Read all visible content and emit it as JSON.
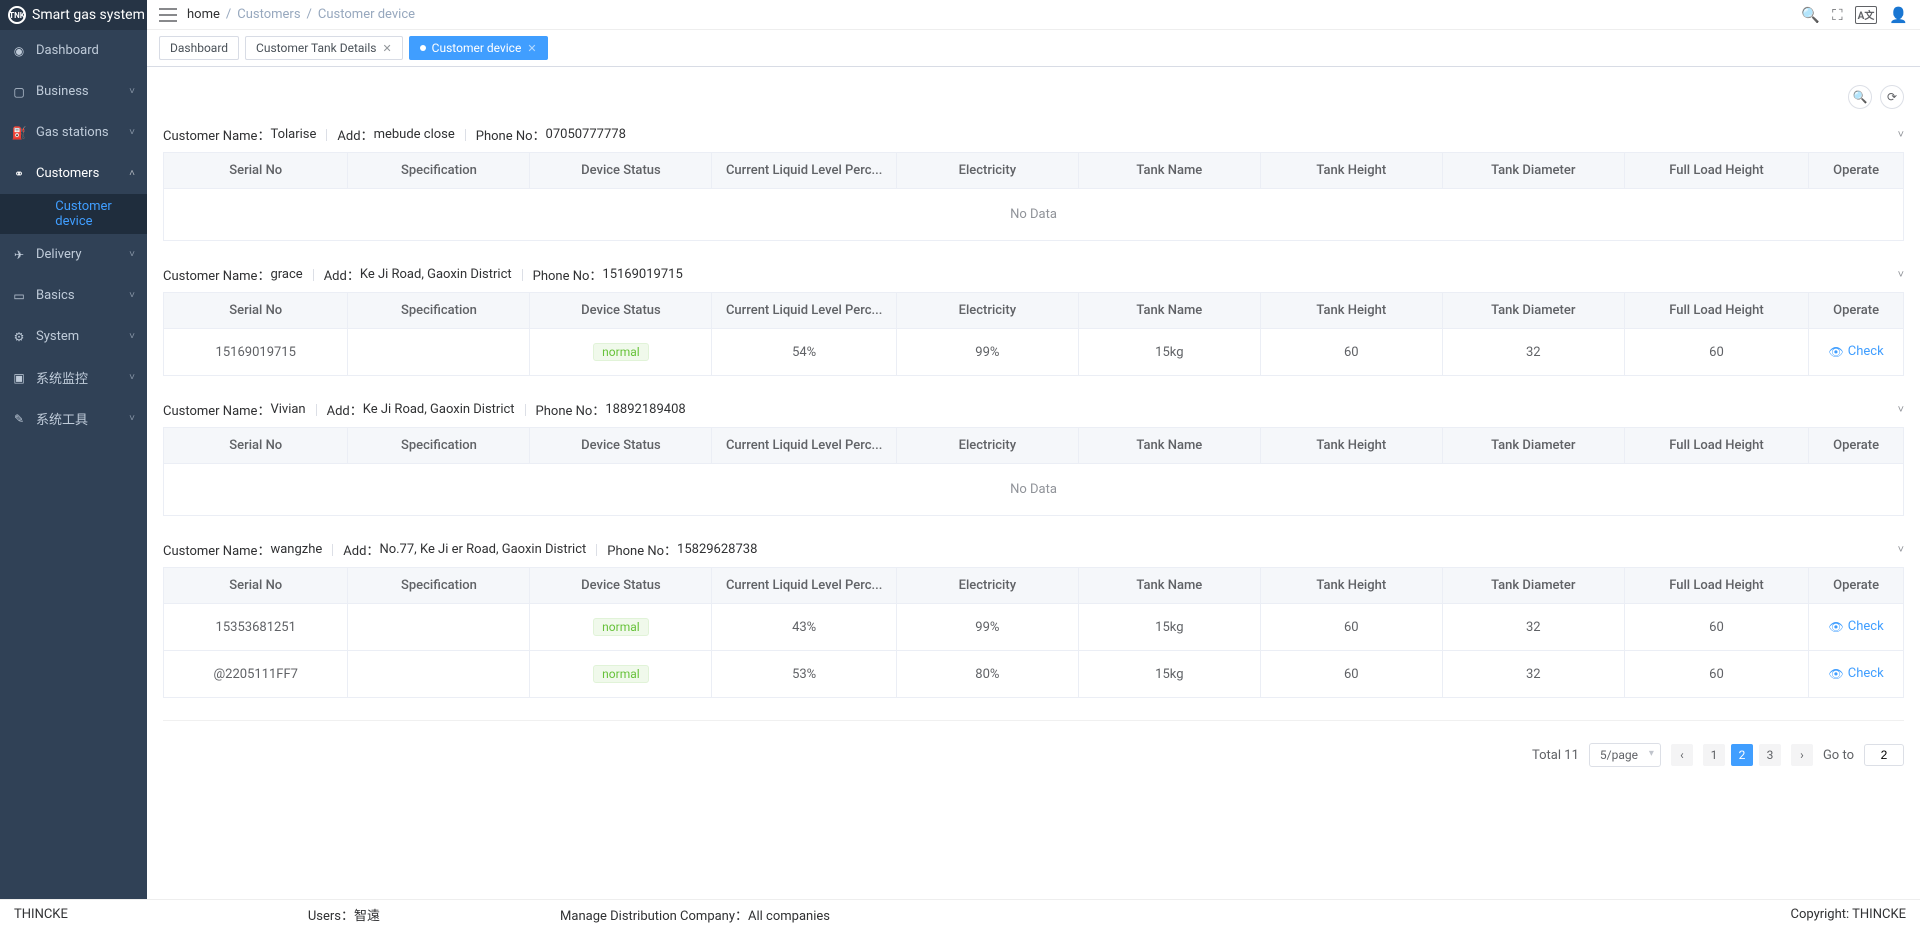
{
  "brand": "Smart gas system",
  "breadcrumbs": {
    "home": "home",
    "sep": "/",
    "parent": "Customers",
    "current": "Customer device"
  },
  "header_icons": {
    "search": "search-icon",
    "fullscreen": "fullscreen-icon",
    "lang": "lang-icon",
    "user": "user-icon"
  },
  "sidebar": [
    {
      "icon": "dashboard-icon",
      "label": "Dashboard",
      "chev": false
    },
    {
      "icon": "business-icon",
      "label": "Business",
      "chev": true
    },
    {
      "icon": "station-icon",
      "label": "Gas stations",
      "chev": true
    },
    {
      "icon": "customers-icon",
      "label": "Customers",
      "chev": true,
      "open": true,
      "active": true,
      "sub": {
        "icon": "code-icon",
        "label": "Customer device"
      }
    },
    {
      "icon": "delivery-icon",
      "label": "Delivery",
      "chev": true
    },
    {
      "icon": "basics-icon",
      "label": "Basics",
      "chev": true
    },
    {
      "icon": "system-icon",
      "label": "System",
      "chev": true
    },
    {
      "icon": "monitor-icon",
      "label": "系统监控",
      "chev": true
    },
    {
      "icon": "tools-icon",
      "label": "系统工具",
      "chev": true
    }
  ],
  "tabs": [
    {
      "label": "Dashboard",
      "closable": false,
      "active": false
    },
    {
      "label": "Customer Tank Details",
      "closable": true,
      "active": false
    },
    {
      "label": "Customer device",
      "closable": true,
      "active": true
    }
  ],
  "labels": {
    "customer_name": "Customer Name：",
    "addr": "Add：",
    "phone": "Phone No：",
    "nodata": "No Data",
    "check": "Check",
    "normal": "normal",
    "total": "Total 11",
    "perpage": "5/page",
    "goto": "Go to",
    "goto_val": "2"
  },
  "columns": [
    "Serial No",
    "Specification",
    "Device Status",
    "Current Liquid Level Perc...",
    "Electricity",
    "Tank Name",
    "Tank Height",
    "Tank Diameter",
    "Full Load Height",
    "Operate"
  ],
  "pager": {
    "prev": "‹",
    "next": "›",
    "pages": [
      "1",
      "2",
      "3"
    ],
    "active": "2"
  },
  "customers": [
    {
      "name": "Tolarise",
      "addr": "mebude close",
      "phone": "07050777778",
      "rows": []
    },
    {
      "name": "grace",
      "addr": "Ke Ji Road, Gaoxin District",
      "phone": "15169019715",
      "rows": [
        {
          "serial": "15169019715",
          "spec": "",
          "status": "normal",
          "level": "54%",
          "elec": "99%",
          "tname": "15kg",
          "theight": "60",
          "tdiam": "32",
          "full": "60"
        }
      ]
    },
    {
      "name": "Vivian",
      "addr": "Ke Ji Road, Gaoxin District",
      "phone": "18892189408",
      "rows": []
    },
    {
      "name": "wangzhe",
      "addr": "No.77, Ke Ji er Road, Gaoxin District",
      "phone": "15829628738",
      "rows": [
        {
          "serial": "15353681251",
          "spec": "",
          "status": "normal",
          "level": "43%",
          "elec": "99%",
          "tname": "15kg",
          "theight": "60",
          "tdiam": "32",
          "full": "60"
        },
        {
          "serial": "@2205111FF7",
          "spec": "",
          "status": "normal",
          "level": "53%",
          "elec": "80%",
          "tname": "15kg",
          "theight": "60",
          "tdiam": "32",
          "full": "60"
        }
      ]
    }
  ],
  "footer": {
    "left": "THINCKE",
    "users_label": "Users：",
    "users_val": "智遠",
    "dist_label": "Manage Distribution Company：",
    "dist_val": "All companies",
    "copy": "Copyright: THINCKE"
  }
}
